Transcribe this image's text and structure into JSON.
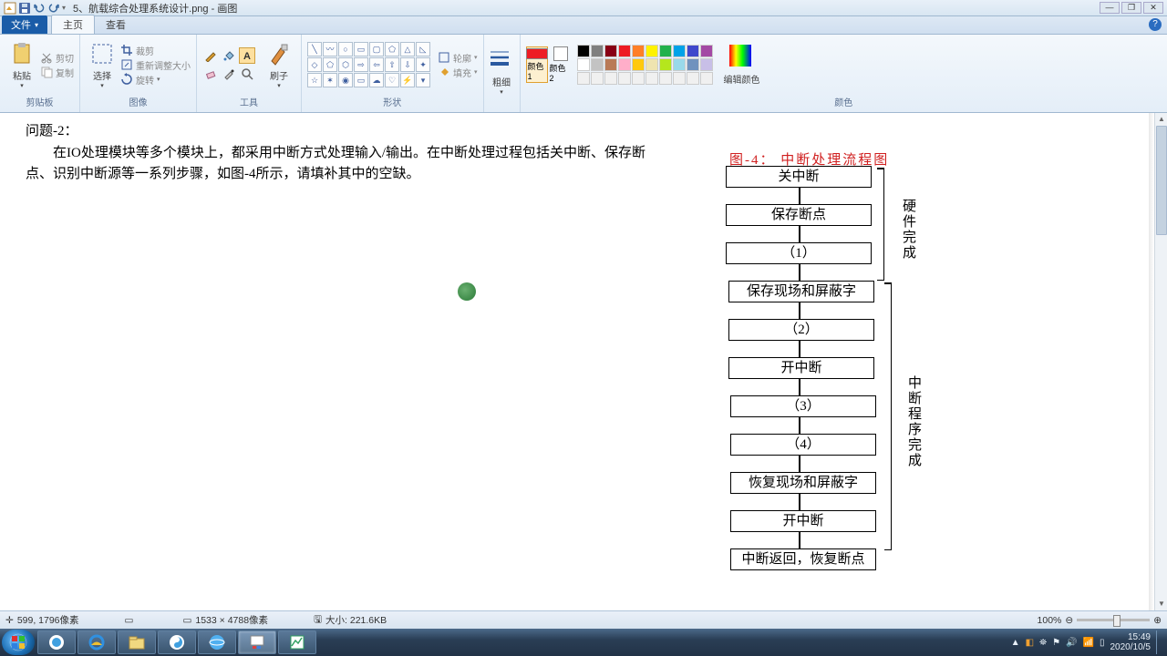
{
  "titlebar": {
    "title": "5、航载综合处理系统设计.png - 画图"
  },
  "window": {
    "min": "—",
    "max": "❐",
    "close": "✕"
  },
  "tabs": {
    "file": "文件",
    "home": "主页",
    "view": "查看"
  },
  "ribbon": {
    "clipboard": {
      "paste": "粘贴",
      "cut": "剪切",
      "copy": "复制",
      "label": "剪贴板"
    },
    "image": {
      "select": "选择",
      "crop": "裁剪",
      "resize": "重新调整大小",
      "rotate": "旋转",
      "label": "图像"
    },
    "tools": {
      "brush": "刷子",
      "label": "工具"
    },
    "shapes": {
      "outline": "轮廓",
      "fill": "填充",
      "label": "形状"
    },
    "stroke": {
      "thick": "粗细",
      "label": ""
    },
    "colors": {
      "c1": "颜色 1",
      "c2": "颜色 2",
      "edit": "编辑颜色",
      "label": "颜色"
    }
  },
  "palette_colors": [
    "#000000",
    "#7f7f7f",
    "#880015",
    "#ed1c24",
    "#ff7f27",
    "#fff200",
    "#22b14c",
    "#00a2e8",
    "#3f48cc",
    "#a349a4",
    "#ffffff",
    "#c3c3c3",
    "#b97a57",
    "#ffaec9",
    "#ffc90e",
    "#efe4b0",
    "#b5e61d",
    "#99d9ea",
    "#7092be",
    "#c8bfe7",
    "#f0f0f0",
    "#f0f0f0",
    "#f0f0f0",
    "#f0f0f0",
    "#f0f0f0",
    "#f0f0f0",
    "#f0f0f0",
    "#f0f0f0",
    "#f0f0f0",
    "#f0f0f0"
  ],
  "question": {
    "title": "问题-2：",
    "body": "在IO处理模块等多个模块上，都采用中断方式处理输入/输出。在中断处理过程包括关中断、保存断点、识别中断源等一系列步骤，如图-4所示，请填补其中的空缺。"
  },
  "flowchart": {
    "title": "图-4：  中断处理流程图",
    "boxes": [
      "关中断",
      "保存断点",
      "（1）",
      "保存现场和屏蔽字",
      "（2）",
      "开中断",
      "（3）",
      "（4）",
      "恢复现场和屏蔽字",
      "开中断",
      "中断返回，恢复断点"
    ],
    "label_hw": "硬件完成",
    "label_sw": "中断程序完成"
  },
  "cursor": {
    "mark": "⦿"
  },
  "status": {
    "pos_icon": "✛",
    "pos": "599, 1796像素",
    "sel_icon": "▭",
    "sel": "",
    "dim_icon": "▭",
    "dim": "1533 × 4788像素",
    "size_icon": "🖫",
    "size": "大小: 221.6KB",
    "zoom": "100%",
    "minus": "⊖",
    "plus": "⊕"
  },
  "tray": {
    "time": "15:49",
    "date": "2020/10/5"
  }
}
